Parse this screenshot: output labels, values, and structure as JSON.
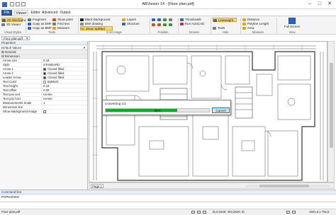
{
  "window": {
    "title": "ABViewer 14 - [Floor plan.pdf]",
    "minimize_glyph": "–",
    "maximize_glyph": "□",
    "close_glyph": "✕"
  },
  "menu_tabs": [
    "File",
    "Viewer",
    "Editor",
    "Advanced",
    "Output"
  ],
  "active_tab": "Viewer",
  "ribbon": {
    "visual_styles": {
      "label": "Visual Styles",
      "buttons": [
        "2D Wireframe",
        "3D Viewer"
      ]
    },
    "tools": {
      "label": "Tools",
      "buttons": [
        "Fragment",
        "Copy as EMF",
        "Copy as BMP",
        "Show point",
        "Find text",
        "Measure"
      ]
    },
    "cad_image": {
      "label": "CAD Image",
      "buttons": [
        "Black Background",
        "B/W drawing",
        "Snow Splitted",
        "Layers",
        "Structure"
      ]
    },
    "position": {
      "label": "Position"
    },
    "browse": {
      "label": "Browse",
      "buttons": [
        "Thumbnails",
        "Run AutoCAD"
      ]
    },
    "hide": {
      "label": "Hide",
      "buttons": [
        "Lineweight",
        "Texts"
      ]
    },
    "measure": {
      "label": "Measure",
      "buttons": [
        "Distance",
        "Polyline Length",
        "Area"
      ]
    },
    "view": {
      "label": "View",
      "buttons": [
        "Full Screen"
      ]
    }
  },
  "document_tab": "Floor plan.pdf",
  "properties": {
    "header": "Properties",
    "selector": "Default Values",
    "categories": [
      "General",
      "Dimension"
    ],
    "rows": [
      {
        "key": "Arrow size",
        "value": "0.18",
        "type": "text"
      },
      {
        "key": "Style",
        "value": "STANDARD",
        "type": "text"
      },
      {
        "key": "Arrow 1",
        "value": "Closed filled",
        "type": "swatch"
      },
      {
        "key": "Arrow 2",
        "value": "Closed filled",
        "type": "swatch"
      },
      {
        "key": "Leader Arrow",
        "value": "Closed filled",
        "type": "swatch"
      },
      {
        "key": "Text Color",
        "value": "ByBlock",
        "type": "swatch"
      },
      {
        "key": "Text height",
        "value": "0.18",
        "type": "text"
      },
      {
        "key": "Text offset",
        "value": "0.09",
        "type": "text"
      },
      {
        "key": "Text pos vert",
        "value": "Center",
        "type": "text"
      },
      {
        "key": "Text pos horz",
        "value": "Center",
        "type": "text"
      },
      {
        "key": "Measurements Scale",
        "value": "1",
        "type": "text"
      },
      {
        "key": "Dimension line",
        "value": "",
        "type": "text"
      },
      {
        "key": "Show Background Image",
        "value": "",
        "type": "check"
      }
    ]
  },
  "progress_dialog": {
    "title": "Converting 1/1",
    "percent": 0.69,
    "percent_label": "69%",
    "cancel_label": "Cancel"
  },
  "page_tab": "Page 1",
  "command_line": {
    "header": "Command line",
    "output": "POPterDWG"
  },
  "status": {
    "file": "Floor plan.pdf",
    "coordinates": "(5,0;3446; 403,2529; 0)",
    "size": "1501,6 x 792,0"
  },
  "colors": {
    "file_tab": "#2b579a",
    "highlight": "#fbd876",
    "progress": "#06b025",
    "accent": "#2a66c9"
  }
}
